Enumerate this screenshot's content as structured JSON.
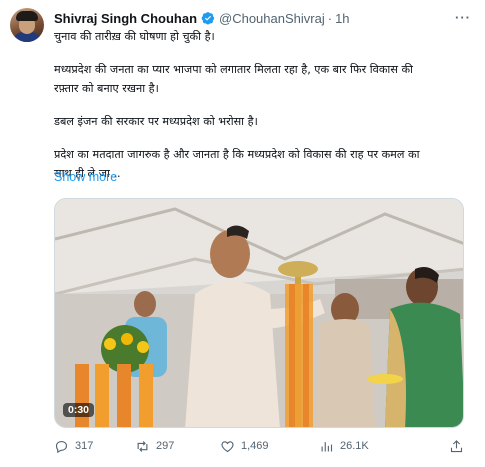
{
  "author": {
    "name": "Shivraj Singh Chouhan",
    "handle": "@ChouhanShivraj",
    "separator": "·",
    "time": "1h"
  },
  "tweet": {
    "line1": "चुनाव की तारीख़ की घोषणा हो चुकी है।",
    "para2a": "मध्यप्रदेश की जनता का प्यार भाजपा को लगातार मिलता रहा है, एक बार फिर विकास की",
    "para2b": "रफ़्तार को बनाए रखना है।",
    "para3": "डबल इंजन की सरकार पर मध्यप्रदेश को भरोसा है।",
    "para4a": "प्रदेश का मतदाता जागरुक है और जानता है कि मध्यप्रदेश को विकास की राह पर कमल का",
    "para4b": "साथ ही ले जा...",
    "show_more": "Show more"
  },
  "video": {
    "duration": "0:30"
  },
  "actions": {
    "replies": "317",
    "retweets": "297",
    "likes": "1,469",
    "views": "26.1K"
  },
  "icons": {
    "verified": "verified-badge-icon",
    "more": "more-options-icon",
    "reply": "reply-icon",
    "retweet": "retweet-icon",
    "like": "heart-icon",
    "views": "views-chart-icon",
    "share": "share-icon"
  },
  "colors": {
    "accent": "#1d9bf0",
    "muted": "#536471"
  }
}
